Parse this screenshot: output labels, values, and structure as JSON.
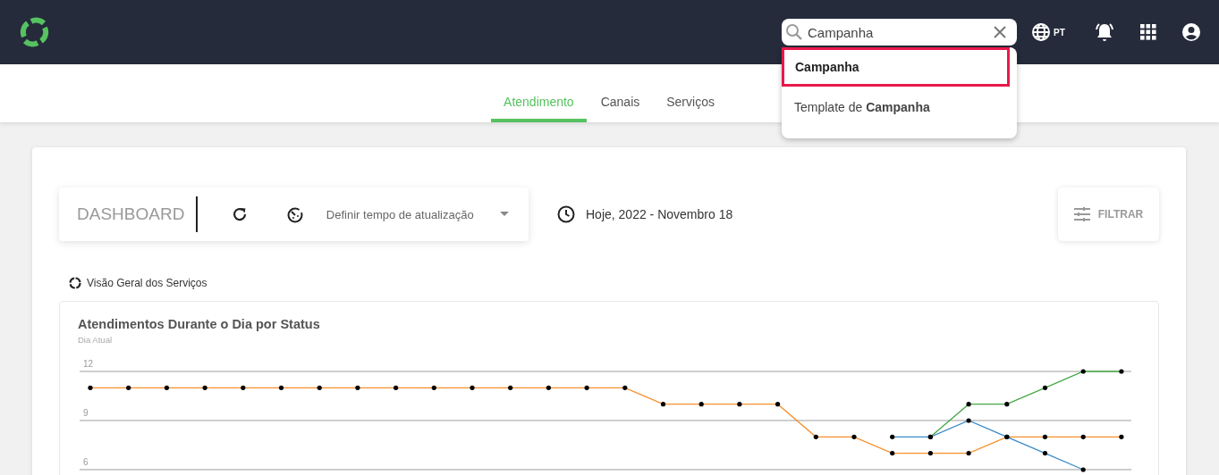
{
  "header": {
    "search": {
      "value": "Campanha"
    },
    "language": "PT",
    "suggestions": [
      {
        "text": "**Campanha**",
        "selected": true
      },
      {
        "text": "Template de **Campanha**",
        "selected": false
      }
    ]
  },
  "tabs": [
    {
      "label": "Atendimento",
      "selected": true
    },
    {
      "label": "Canais",
      "selected": false
    },
    {
      "label": "Serviços",
      "selected": false
    }
  ],
  "toolbar": {
    "title": "DASHBOARD",
    "refresh_select": {
      "placeholder": "Definir tempo de atualização"
    },
    "date": "Hoje, 2022 - Novembro 18",
    "filter_button": "FILTRAR"
  },
  "section_label": "Visão Geral dos Serviços",
  "panel": {
    "title": "Atendimentos Durante o Dia por Status",
    "subtitle": "Dia Atual",
    "chart_data": {
      "type": "line",
      "grid": true,
      "ylim": [
        6,
        12
      ],
      "yticks": [
        12,
        9,
        6
      ],
      "series": [
        {
          "color": "#f7902d",
          "values": [
            11,
            11,
            11,
            11,
            11,
            11,
            11,
            11,
            11,
            11,
            11,
            11,
            11,
            11,
            11,
            10,
            10,
            10,
            10,
            8,
            8,
            7,
            7,
            7,
            8,
            8,
            8,
            8
          ]
        },
        {
          "color": "#3b8bc7",
          "values": [
            null,
            null,
            null,
            null,
            null,
            null,
            null,
            null,
            null,
            null,
            null,
            null,
            null,
            null,
            null,
            null,
            null,
            null,
            null,
            null,
            null,
            8,
            8,
            9,
            8,
            7,
            6,
            null
          ]
        },
        {
          "color": "#45a845",
          "values": [
            null,
            null,
            null,
            null,
            null,
            null,
            null,
            null,
            null,
            null,
            null,
            null,
            null,
            null,
            null,
            null,
            null,
            null,
            null,
            null,
            null,
            null,
            8,
            10,
            10,
            11,
            12,
            12
          ]
        }
      ]
    }
  }
}
